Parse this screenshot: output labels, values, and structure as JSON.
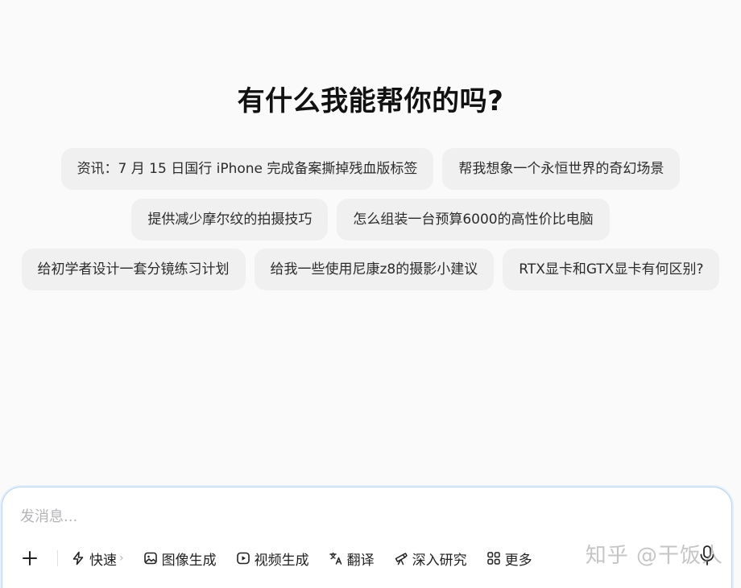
{
  "headline": "有什么我能帮你的吗?",
  "suggestions": {
    "row1": [
      "资讯：7 月 15 日国行 iPhone 完成备案撕掉残血版标签",
      "帮我想象一个永恒世界的奇幻场景"
    ],
    "row2": [
      "提供减少摩尔纹的拍摄技巧",
      "怎么组装一台预算6000的高性价比电脑"
    ],
    "row3": [
      "给初学者设计一套分镜练习计划",
      "给我一些使用尼康z8的摄影小建议",
      "RTX显卡和GTX显卡有何区别?"
    ]
  },
  "composer": {
    "placeholder": "发消息...",
    "value": ""
  },
  "toolbar": {
    "plus_icon": "plus-icon",
    "items": [
      {
        "label": "快速",
        "icon": "lightning-icon",
        "chevron": "›"
      },
      {
        "label": "图像生成",
        "icon": "image-icon"
      },
      {
        "label": "视频生成",
        "icon": "video-icon"
      },
      {
        "label": "翻译",
        "icon": "translate-icon"
      },
      {
        "label": "深入研究",
        "icon": "telescope-icon"
      },
      {
        "label": "更多",
        "icon": "grid-icon"
      }
    ],
    "mic_icon": "microphone-icon"
  },
  "watermark": "知乎 @干饭人",
  "colors": {
    "background": "#fafafb",
    "chip_bg": "#f0f0f1",
    "composer_border": "#b9d4ee"
  }
}
